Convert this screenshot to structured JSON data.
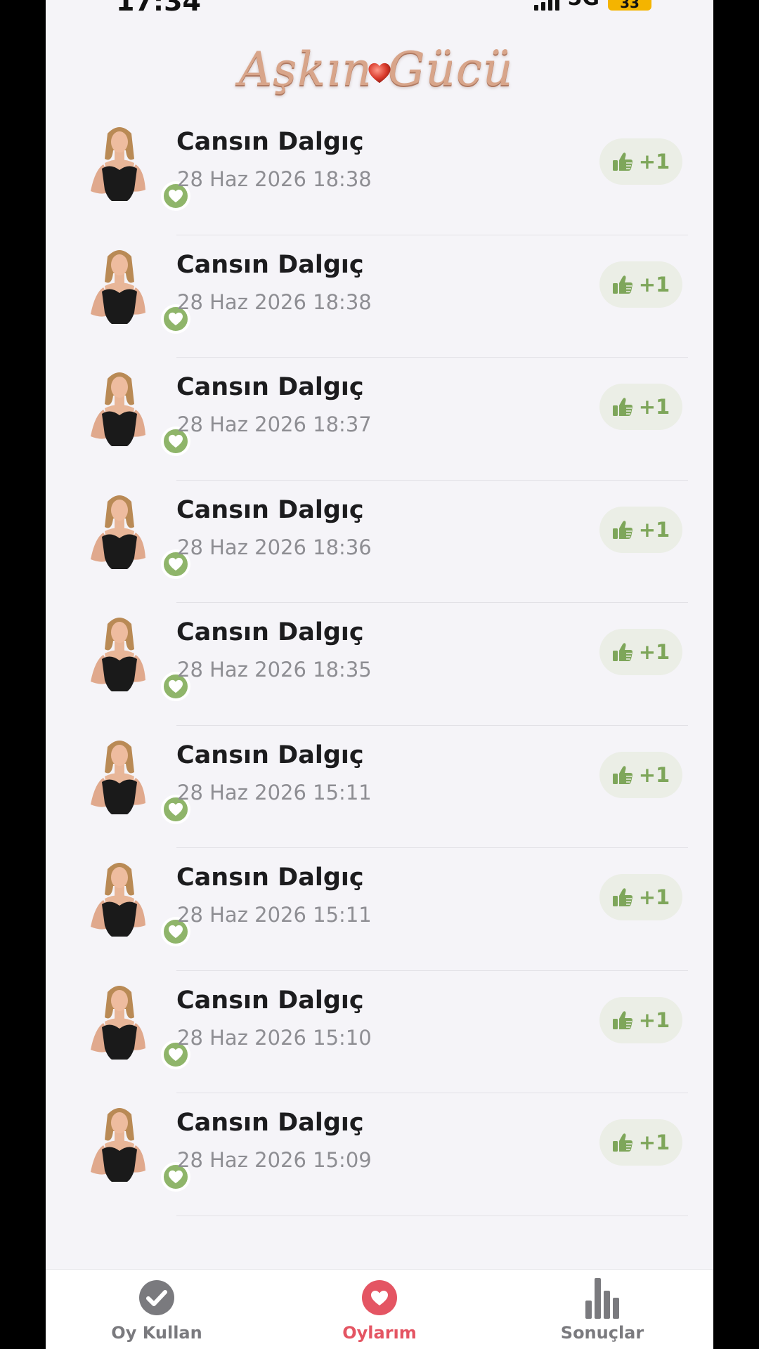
{
  "status": {
    "time": "17:34",
    "network": "5G",
    "battery": "33"
  },
  "logo": {
    "text": "Aşkın Gücü"
  },
  "colors": {
    "accent_green": "#8fb56a",
    "accent_red": "#e45563",
    "logo_rose_gold": "#d8a58a"
  },
  "votes": [
    {
      "name": "Cansın Dalgıç",
      "date": "28 Haz 2026 18:38",
      "points": "+1"
    },
    {
      "name": "Cansın Dalgıç",
      "date": "28 Haz 2026 18:38",
      "points": "+1"
    },
    {
      "name": "Cansın Dalgıç",
      "date": "28 Haz 2026 18:37",
      "points": "+1"
    },
    {
      "name": "Cansın Dalgıç",
      "date": "28 Haz 2026 18:36",
      "points": "+1"
    },
    {
      "name": "Cansın Dalgıç",
      "date": "28 Haz 2026 18:35",
      "points": "+1"
    },
    {
      "name": "Cansın Dalgıç",
      "date": "28 Haz 2026 15:11",
      "points": "+1"
    },
    {
      "name": "Cansın Dalgıç",
      "date": "28 Haz 2026 15:11",
      "points": "+1"
    },
    {
      "name": "Cansın Dalgıç",
      "date": "28 Haz 2026 15:10",
      "points": "+1"
    },
    {
      "name": "Cansın Dalgıç",
      "date": "28 Haz 2026 15:09",
      "points": "+1"
    }
  ],
  "tabbar": {
    "tabs": [
      {
        "label": "Oy Kullan",
        "icon": "check-circle-icon",
        "color": "#7a7a7e",
        "active": false
      },
      {
        "label": "Oylarım",
        "icon": "heart-circle-icon",
        "color": "#e45563",
        "active": true
      },
      {
        "label": "Sonuçlar",
        "icon": "bar-chart-icon",
        "color": "#7a7a7e",
        "active": false
      }
    ]
  }
}
